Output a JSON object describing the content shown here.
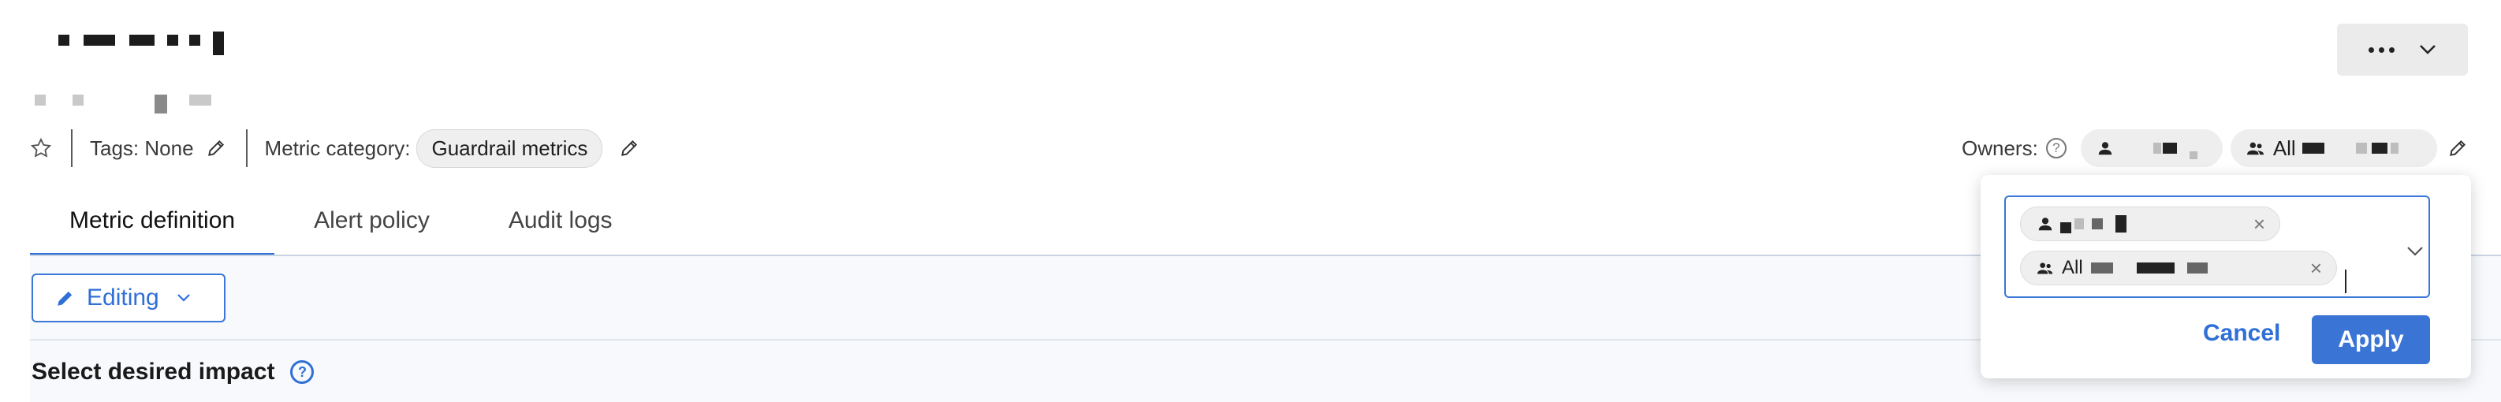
{
  "header": {
    "more_button_icon": "more-horizontal-icon",
    "more_button_chevron": "chevron-down-icon"
  },
  "meta": {
    "tags_label": "Tags: None",
    "category_label": "Metric category:",
    "category_value": "Guardrail metrics",
    "owners_label": "Owners:",
    "owner_group_prefix": "All"
  },
  "tabs": [
    {
      "label": "Metric definition",
      "active": true
    },
    {
      "label": "Alert policy",
      "active": false
    },
    {
      "label": "Audit logs",
      "active": false
    }
  ],
  "editing_button": {
    "label": "Editing"
  },
  "section": {
    "title": "Select desired impact"
  },
  "popover": {
    "group_chip_prefix": "All",
    "cancel_label": "Cancel",
    "apply_label": "Apply"
  },
  "colors": {
    "accent": "#2f6fd6",
    "apply_bg": "#3a74d5"
  }
}
